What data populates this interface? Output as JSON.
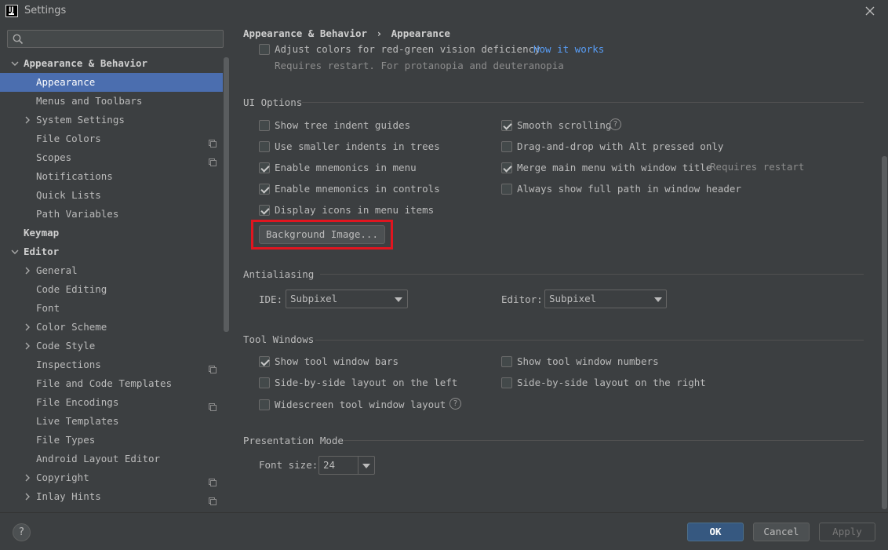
{
  "window": {
    "title": "Settings",
    "app_icon_text": "IJ"
  },
  "sidebar": {
    "search_placeholder": "",
    "items": [
      {
        "label": "Appearance & Behavior",
        "level": 0,
        "expanded": true,
        "bold": true
      },
      {
        "label": "Appearance",
        "level": 1,
        "selected": true
      },
      {
        "label": "Menus and Toolbars",
        "level": 1
      },
      {
        "label": "System Settings",
        "level": 1,
        "collapsed": true
      },
      {
        "label": "File Colors",
        "level": 1,
        "project_icon": true
      },
      {
        "label": "Scopes",
        "level": 1,
        "project_icon": true
      },
      {
        "label": "Notifications",
        "level": 1
      },
      {
        "label": "Quick Lists",
        "level": 1
      },
      {
        "label": "Path Variables",
        "level": 1
      },
      {
        "label": "Keymap",
        "level": 0,
        "bold": true
      },
      {
        "label": "Editor",
        "level": 0,
        "expanded": true,
        "bold": true
      },
      {
        "label": "General",
        "level": 1,
        "collapsed": true
      },
      {
        "label": "Code Editing",
        "level": 1
      },
      {
        "label": "Font",
        "level": 1
      },
      {
        "label": "Color Scheme",
        "level": 1,
        "collapsed": true
      },
      {
        "label": "Code Style",
        "level": 1,
        "collapsed": true
      },
      {
        "label": "Inspections",
        "level": 1,
        "project_icon": true
      },
      {
        "label": "File and Code Templates",
        "level": 1
      },
      {
        "label": "File Encodings",
        "level": 1,
        "project_icon": true
      },
      {
        "label": "Live Templates",
        "level": 1
      },
      {
        "label": "File Types",
        "level": 1
      },
      {
        "label": "Android Layout Editor",
        "level": 1
      },
      {
        "label": "Copyright",
        "level": 1,
        "collapsed": true,
        "project_icon": true
      },
      {
        "label": "Inlay Hints",
        "level": 1,
        "collapsed": true,
        "project_icon": true
      }
    ]
  },
  "breadcrumb": {
    "parent": "Appearance & Behavior",
    "separator": "›",
    "current": "Appearance"
  },
  "top_option": {
    "label": "Adjust colors for red-green vision deficiency",
    "checked": false,
    "link": "How it works",
    "hint": "Requires restart. For protanopia and deuteranopia"
  },
  "ui_options": {
    "title": "UI Options",
    "left": [
      {
        "label": "Show tree indent guides",
        "checked": false
      },
      {
        "label": "Use smaller indents in trees",
        "checked": false
      },
      {
        "label": "Enable mnemonics in menu",
        "checked": true
      },
      {
        "label": "Enable mnemonics in controls",
        "checked": true
      },
      {
        "label": "Display icons in menu items",
        "checked": true
      }
    ],
    "right": [
      {
        "label": "Smooth scrolling",
        "checked": true,
        "help": true
      },
      {
        "label": "Drag-and-drop with Alt pressed only",
        "checked": false
      },
      {
        "label": "Merge main menu with window title",
        "checked": true,
        "hint": "Requires restart"
      },
      {
        "label": "Always show full path in window header",
        "checked": false
      }
    ],
    "background_button": "Background Image..."
  },
  "antialiasing": {
    "title": "Antialiasing",
    "ide_label": "IDE:",
    "ide_value": "Subpixel",
    "editor_label": "Editor:",
    "editor_value": "Subpixel"
  },
  "tool_windows": {
    "title": "Tool Windows",
    "left": [
      {
        "label": "Show tool window bars",
        "checked": true
      },
      {
        "label": "Side-by-side layout on the left",
        "checked": false
      },
      {
        "label": "Widescreen tool window layout",
        "checked": false,
        "help": true
      }
    ],
    "right": [
      {
        "label": "Show tool window numbers",
        "checked": false
      },
      {
        "label": "Side-by-side layout on the right",
        "checked": false
      }
    ]
  },
  "presentation": {
    "title": "Presentation Mode",
    "font_label": "Font size:",
    "font_value": "24"
  },
  "footer": {
    "help": "?",
    "ok": "OK",
    "cancel": "Cancel",
    "apply": "Apply"
  },
  "colors": {
    "background": "#3c3f41",
    "selection": "#4b6eaf",
    "link": "#589df6",
    "highlight": "#e0151f",
    "ok_button": "#365880"
  }
}
